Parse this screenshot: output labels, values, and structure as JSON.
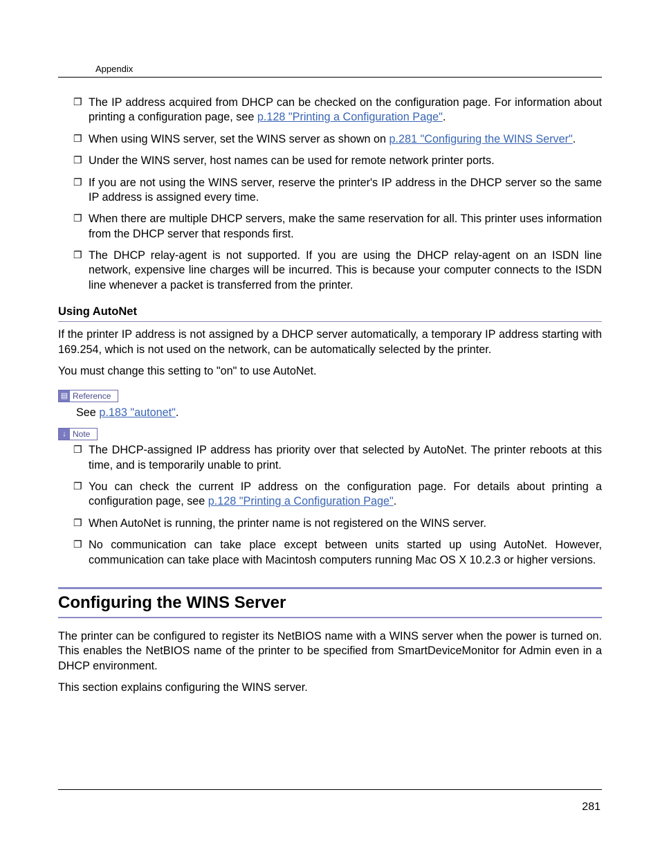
{
  "header": {
    "text": "Appendix"
  },
  "notes1": [
    {
      "pre": "The IP address acquired from DHCP can be checked on the configuration page. For information about printing a configuration page, see ",
      "link": "p.128 \"Printing a Configuration Page\"",
      "post": "."
    },
    {
      "pre": "When using WINS server, set the WINS server as shown on ",
      "link": "p.281 \"Configuring the WINS Server\"",
      "post": "."
    },
    {
      "pre": "Under the WINS server, host names can be used for remote network printer ports.",
      "link": "",
      "post": ""
    },
    {
      "pre": "If you are not using the WINS server, reserve the printer's IP address in the DHCP server so the same IP address is assigned every time.",
      "link": "",
      "post": ""
    },
    {
      "pre": "When there are multiple DHCP servers, make the same reservation for all. This printer uses information from the DHCP server that responds first.",
      "link": "",
      "post": ""
    },
    {
      "pre": "The DHCP relay-agent is not supported. If you are using the DHCP relay-agent on an ISDN line network, expensive line charges will be incurred. This is because your computer connects to the ISDN line whenever a packet is transferred from the printer.",
      "link": "",
      "post": ""
    }
  ],
  "autonet": {
    "heading": "Using AutoNet",
    "p1": "If the printer IP address is not assigned by a DHCP server automatically, a temporary IP address starting with 169.254, which is not used on the network, can be automatically selected by the printer.",
    "p2": "You must change this setting to \"on\" to use AutoNet.",
    "reference_label": "Reference",
    "reference_pre": "See ",
    "reference_link": "p.183 \"autonet\"",
    "reference_post": ".",
    "note_label": "Note"
  },
  "notes2": [
    {
      "pre": "The DHCP-assigned IP address has priority over that selected by AutoNet. The printer reboots at this time, and is temporarily unable to print.",
      "link": "",
      "post": ""
    },
    {
      "pre": "You can check the current IP address on the configuration page. For details about printing a configuration page, see ",
      "link": "p.128 \"Printing a Configuration Page\"",
      "post": "."
    },
    {
      "pre": "When AutoNet is running, the printer name is not registered on the WINS server.",
      "link": "",
      "post": ""
    },
    {
      "pre": "No communication can take place except between units started up using AutoNet. However, communication can take place with Macintosh computers running Mac OS X 10.2.3 or higher versions.",
      "link": "",
      "post": ""
    }
  ],
  "wins": {
    "title": "Configuring the WINS Server",
    "p1": "The printer can be configured to register its NetBIOS name with a WINS server when the power is turned on. This enables the NetBIOS name of the printer to be specified from SmartDeviceMonitor for Admin even in a DHCP environment.",
    "p2": "This section explains configuring the WINS server."
  },
  "page_number": "281"
}
